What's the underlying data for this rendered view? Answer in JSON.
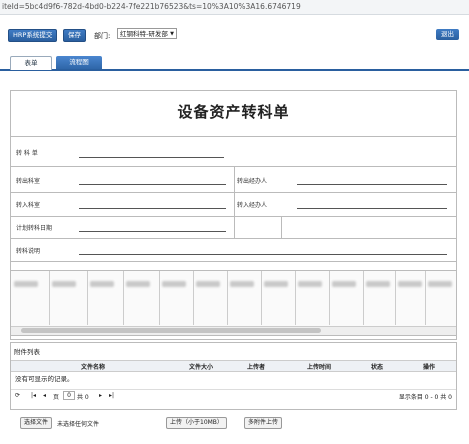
{
  "url": "iteId=5bc4d9f6-782d-4bd0-b224-7fe221b76523&ts=10%3A10%3A16.6746719",
  "toolbar": {
    "submit_label": "HRP系统提交",
    "save_label": "保存",
    "dept_label": "部门:",
    "dept_value": "红钢科特-研发部",
    "logout_label": "退出"
  },
  "tabs": [
    {
      "label": "表单"
    },
    {
      "label": "流程图"
    }
  ],
  "form": {
    "title": "设备资产转科单",
    "fields": {
      "transfer_no": "转 科 单",
      "from_dept": "转出科室",
      "from_handler": "转出经办人",
      "to_dept": "转入科室",
      "to_handler": "转入经办人",
      "plan_date": "计划转科日期",
      "remark": "转科说明"
    }
  },
  "attachments": {
    "title": "附件列表",
    "columns": [
      "文件名称",
      "文件大小",
      "上传者",
      "上传时间",
      "状态",
      "操作"
    ],
    "empty_text": "没有可显示的记录。",
    "pager": {
      "page_prefix": "页",
      "page_value": "0",
      "page_suffix": "共 0",
      "summary": "显示条目 0 - 0 共 0"
    }
  },
  "upload": {
    "choose_label": "选择文件",
    "no_file_text": "未选择任何文件",
    "upload_label": "上传（小于10MB）",
    "bulk_label": "多附件上传"
  }
}
